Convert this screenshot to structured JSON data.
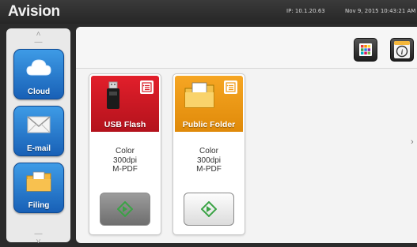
{
  "header": {
    "logo": "Avision",
    "ip": "IP: 10.1.20.63",
    "datetime": "Nov 9, 2015 10:43:21 AM"
  },
  "sidebar": {
    "items": [
      {
        "label": "Cloud",
        "icon": "cloud-icon"
      },
      {
        "label": "E-mail",
        "icon": "envelope-icon"
      },
      {
        "label": "Filing",
        "icon": "folder-icon"
      }
    ]
  },
  "toolbar": {
    "apps_icon": "grid-icon",
    "info_icon": "info-icon"
  },
  "cards": [
    {
      "title": "USB Flash",
      "icon": "usb-drive-icon",
      "settings": [
        "Color",
        "300dpi",
        "M-PDF"
      ],
      "accent": "#d81b25"
    },
    {
      "title": "Public Folder",
      "icon": "folder-icon",
      "settings": [
        "Color",
        "300dpi",
        "M-PDF"
      ],
      "accent": "#f19a14"
    }
  ],
  "colors": {
    "sidebar_button": "#2a7fd6",
    "scan_green": "#3aa345"
  }
}
